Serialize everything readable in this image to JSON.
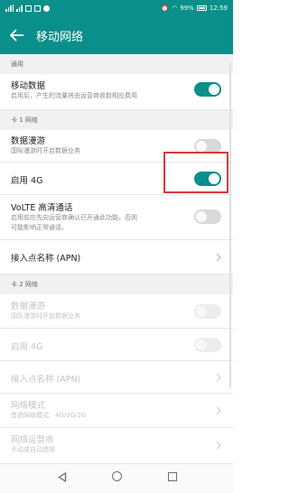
{
  "status_bar": {
    "battery": "99%",
    "time": "12:59"
  },
  "app_bar": {
    "title": "移动网络",
    "back_icon": "arrow-left-icon"
  },
  "sections": {
    "general": "通用",
    "sim1": "卡 1 网络",
    "sim2": "卡 2 网络"
  },
  "rows": {
    "mobile_data": {
      "title": "移动数据",
      "subtitle": "启用后，产生的流量将由运营商收取相应费用",
      "enabled": true
    },
    "roaming1": {
      "title": "数据漫游",
      "subtitle": "国际漫游时开启数据业务",
      "enabled": false
    },
    "enable_4g_1": {
      "title": "启用 4G",
      "enabled": true
    },
    "volte": {
      "title": "VoLTE 高清通话",
      "subtitle_line1": "启用前应先向运营商确认已开通此功能，否则",
      "subtitle_line2": "可能影响正常通话。",
      "enabled": false
    },
    "apn1": {
      "title": "接入点名称 (APN)"
    },
    "roaming2": {
      "title": "数据漫游",
      "subtitle": "国际漫游时开启数据业务",
      "enabled": false
    },
    "enable_4g_2": {
      "title": "启用 4G",
      "enabled": false
    },
    "apn2": {
      "title": "接入点名称 (APN)"
    },
    "network_mode": {
      "title": "网络模式",
      "subtitle": "首选网络模式：4G/3G/2G"
    },
    "operator": {
      "title": "网络运营商",
      "subtitle": "手动或自动选择"
    }
  },
  "colors": {
    "accent": "#0a8f8a",
    "highlight": "#d9383a"
  }
}
